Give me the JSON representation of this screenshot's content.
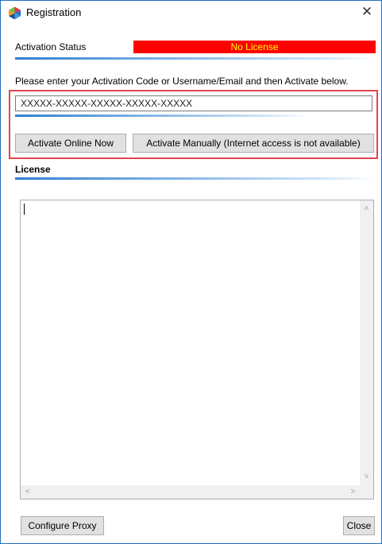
{
  "window": {
    "title": "Registration",
    "close_glyph": "✕"
  },
  "activation": {
    "label": "Activation Status",
    "status": "No License",
    "status_bg": "#ff0000",
    "status_fg": "#ffff00"
  },
  "instructions": "Please enter your Activation Code or Username/Email and then Activate below.",
  "code_input": {
    "value": "XXXXX-XXXXX-XXXXX-XXXXX-XXXXX"
  },
  "buttons": {
    "activate_online": "Activate Online Now",
    "activate_manual": "Activate Manually (Internet access is not available)",
    "configure_proxy": "Configure Proxy",
    "close": "Close"
  },
  "license": {
    "heading": "License",
    "text": ""
  },
  "scroll_arrows": {
    "up": "˄",
    "down": "˅",
    "left": "<",
    "right": ">"
  },
  "colors": {
    "highlight_border": "#e0464e",
    "accent_line": "#2f7fd0"
  },
  "icons": {
    "app": "app-logo-icon"
  }
}
